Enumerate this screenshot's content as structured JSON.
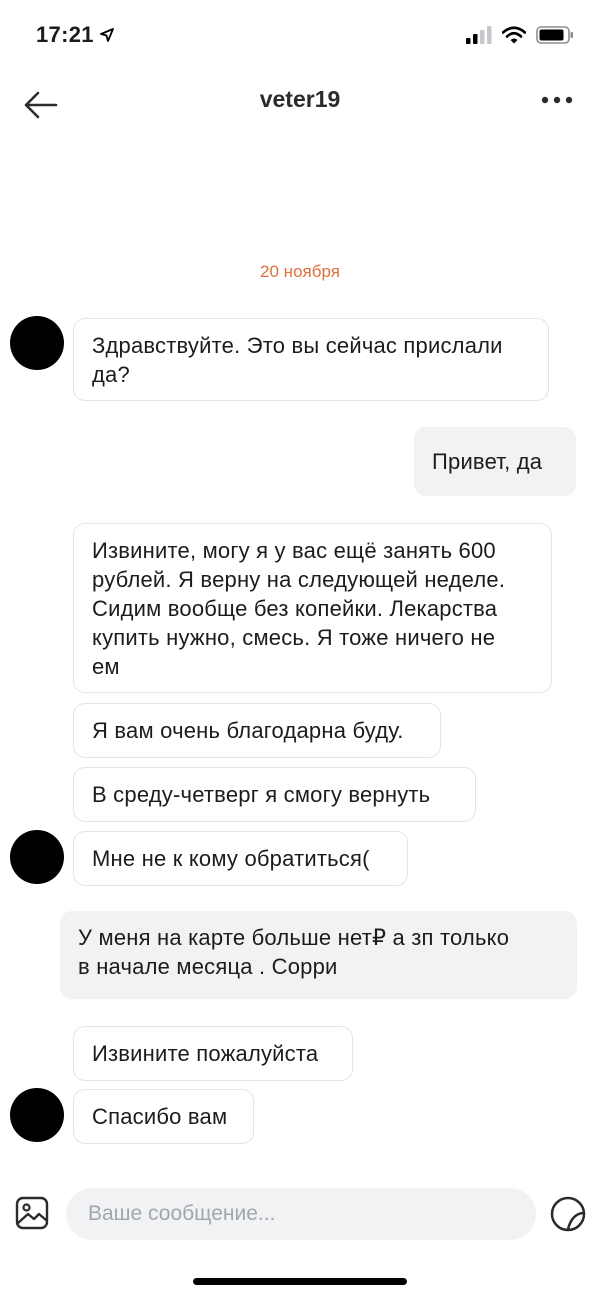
{
  "status_bar": {
    "time": "17:21"
  },
  "header": {
    "title": "veter19"
  },
  "date_separator": "20 ноября",
  "messages": [
    {
      "text": "Здравствуйте. Это вы сейчас прислали\nда?"
    },
    {
      "text": "Привет, да"
    },
    {
      "text": "Извините, могу я у вас ещё занять 600\nрублей. Я верну на следующей неделе.\nСидим вообще без копейки. Лекарства\nкупить нужно,  смесь. Я тоже ничего не\nем"
    },
    {
      "text": "Я вам очень благодарна буду."
    },
    {
      "text": "В среду-четверг я смогу вернуть"
    },
    {
      "text": "Мне не к кому обратиться("
    },
    {
      "text": "У меня на карте больше нет₽ а зп только\nв начале месяца . Сорри"
    },
    {
      "text": "Извините пожалуйста"
    },
    {
      "text": "Спасибо вам"
    }
  ],
  "composer": {
    "placeholder": "Ваше сообщение..."
  },
  "colors": {
    "date_accent": "#e0703b",
    "outgoing_bubble": "#f1f2f4",
    "incoming_border": "#e3e4e8"
  },
  "icons": {
    "back": "arrow-left-icon",
    "more": "more-dots-icon",
    "attach": "image-icon",
    "sticker": "sticker-icon",
    "location": "location-arrow-icon",
    "signal": "signal-icon",
    "wifi": "wifi-icon",
    "battery": "battery-icon"
  }
}
